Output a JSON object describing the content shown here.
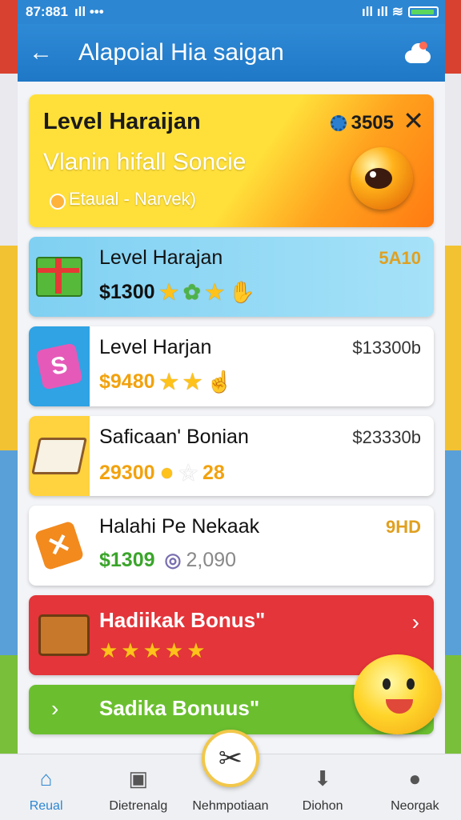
{
  "status": {
    "time": "87:881",
    "icons": "ıll ••• ",
    "signal": "ıll ıll ≋"
  },
  "appbar": {
    "back_icon": "←",
    "title": "Alapoial Hia saigan"
  },
  "hero": {
    "title": "Level Haraijan",
    "coins": "3505",
    "close": "✕",
    "subtitle": "Vlanin hifall Soncie",
    "small": "Etaual - Narvek)"
  },
  "items": [
    {
      "name": "Level Harajan",
      "price": "5A10",
      "value": "$1300",
      "value_color": "#111111"
    },
    {
      "name": "Level Harjan",
      "price": "$13300b",
      "value": "$9480",
      "value_color": "#f2a20e"
    },
    {
      "name": "Saficaan' Bonian",
      "price": "$23330b",
      "value": "29300",
      "value_color": "#f2a20e",
      "extra": "28"
    },
    {
      "name": "Halahi Pe Nekaak",
      "price": "9HD",
      "value": "$1309",
      "value_color": "#3aa52a",
      "extra": "2,090"
    }
  ],
  "red_bonus": {
    "name": "Hadiikak Bonus\"",
    "stars": "★★★★★",
    "chevron": "›"
  },
  "green_bonus": {
    "name": "Sadika Bonuus\"",
    "chevron": "›"
  },
  "nav": [
    {
      "label": "Reual",
      "icon": "home-icon"
    },
    {
      "label": "Dietrenalg",
      "icon": "calendar-icon"
    },
    {
      "label": "Nehmpotiaan",
      "icon": "tools-icon"
    },
    {
      "label": "Diohon",
      "icon": "download-icon"
    },
    {
      "label": "Neorgak",
      "icon": "person-icon"
    }
  ]
}
